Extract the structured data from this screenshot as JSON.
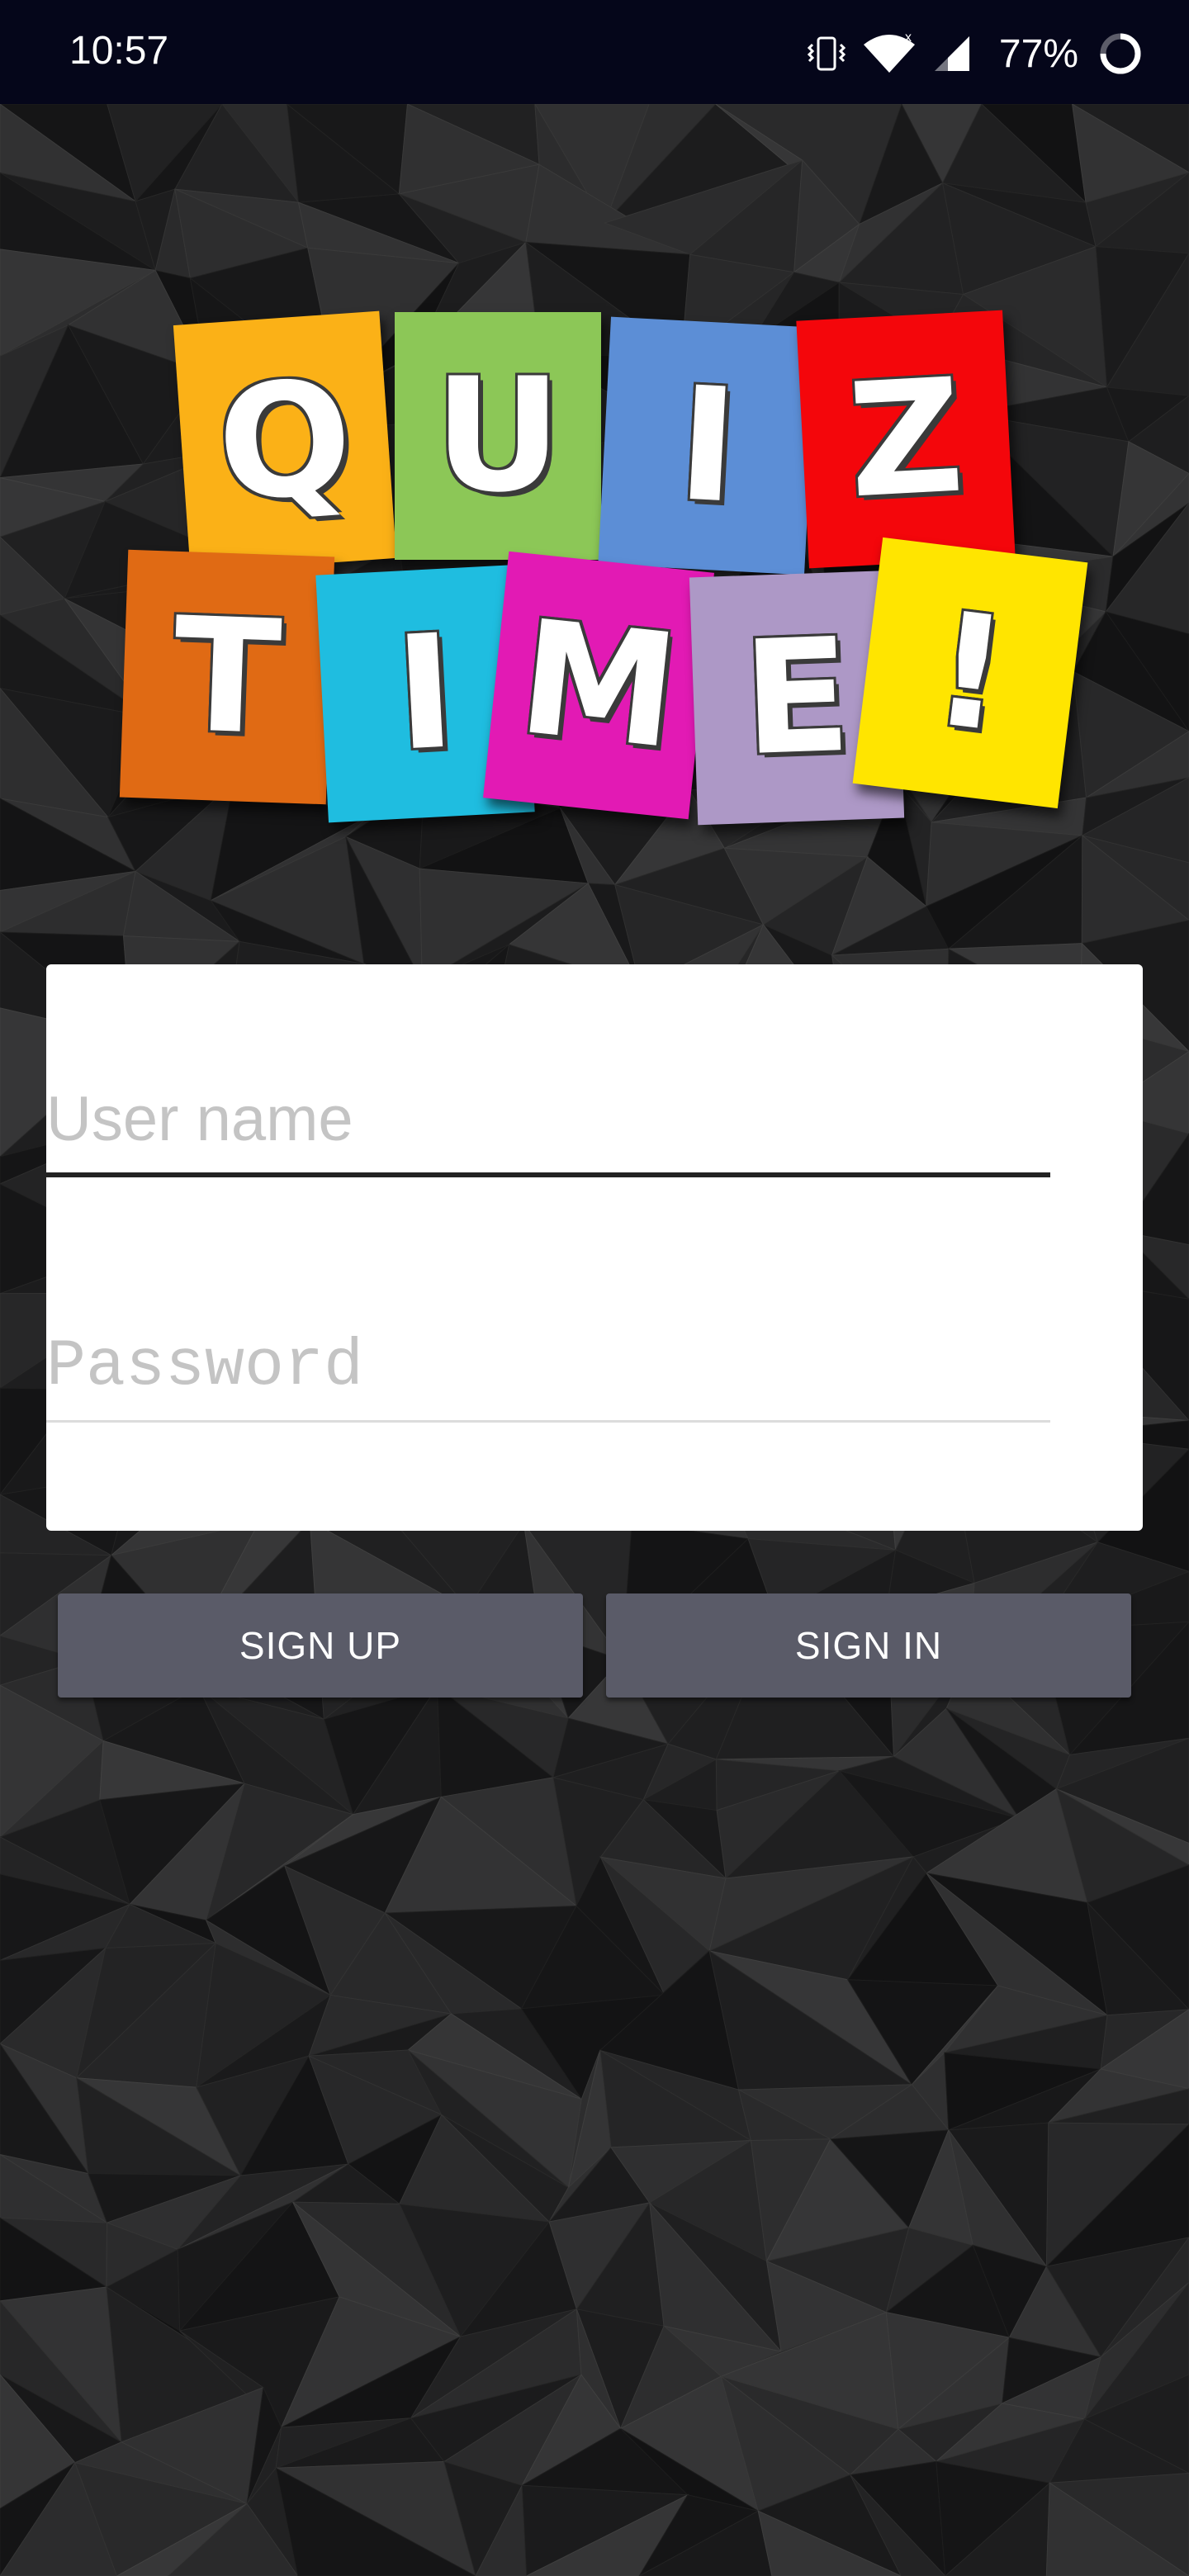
{
  "status_bar": {
    "time": "10:57",
    "battery": "77%",
    "icons": [
      "vibrate-icon",
      "wifi-icon",
      "signal-icon",
      "battery-icon"
    ]
  },
  "logo": {
    "alt_text": "QUIZ TIME!",
    "row1": [
      {
        "letter": "Q",
        "color": "#fbb117"
      },
      {
        "letter": "U",
        "color": "#8cc757"
      },
      {
        "letter": "I",
        "color": "#5c8ed6"
      },
      {
        "letter": "Z",
        "color": "#f4060b"
      }
    ],
    "row2": [
      {
        "letter": "T",
        "color": "#e06a14"
      },
      {
        "letter": "I",
        "color": "#1fbde0"
      },
      {
        "letter": "M",
        "color": "#e21ab4"
      },
      {
        "letter": "E",
        "color": "#ad98c6"
      },
      {
        "letter": "!",
        "color": "#ffe500"
      }
    ]
  },
  "form": {
    "username_placeholder": "User name",
    "username_value": "",
    "password_placeholder": "Password",
    "password_value": ""
  },
  "buttons": {
    "sign_up": "SIGN UP",
    "sign_in": "SIGN IN"
  },
  "colors": {
    "status_bar": "#05061a",
    "button": "#5a5b68",
    "card": "#ffffff"
  }
}
